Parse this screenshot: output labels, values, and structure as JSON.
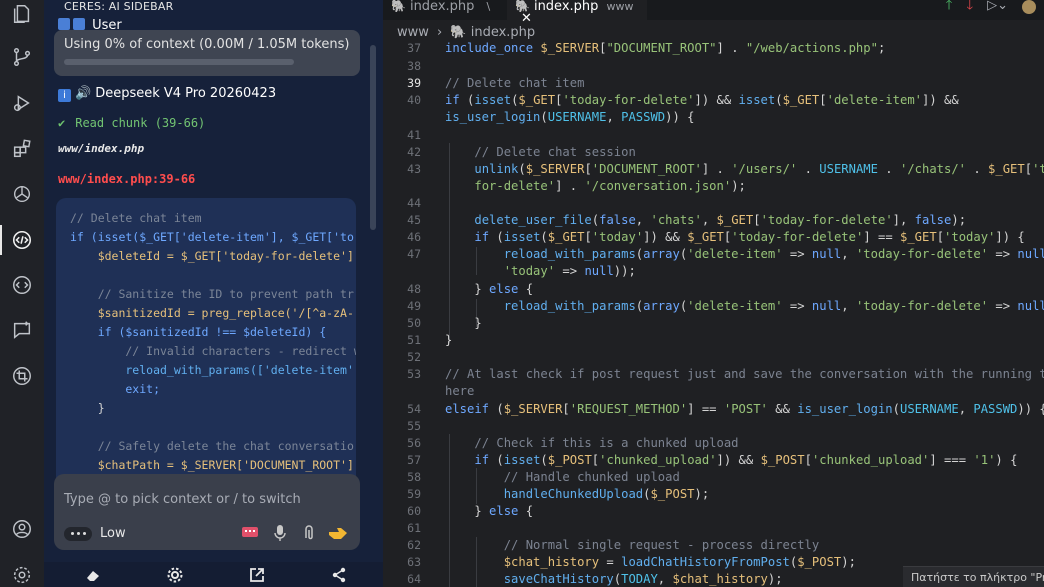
{
  "sidebar": {
    "title": "CERES: AI SIDEBAR",
    "user_label": "User",
    "context_usage": "Using 0% of context (0.00M / 1.05M tokens)",
    "model_label": "Deepseek V4 Pro 20260423",
    "read_status": "Read chunk (39-66)",
    "file_path": "www/index.php",
    "file_range": "www/index.php:39-66",
    "snippet_lines": [
      "// Delete chat item",
      "if (isset($_GET['delete-item'], $_GET['to",
      "    $deleteId = $_GET['today-for-delete']",
      "",
      "    // Sanitize the ID to prevent path tr",
      "    $sanitizedId = preg_replace('/[^a-zA-",
      "    if ($sanitizedId !== $deleteId) {",
      "        // Invalid characters - redirect w",
      "        reload_with_params(['delete-item'",
      "        exit;",
      "    }",
      "",
      "    // Safely delete the chat conversatio",
      "    $chatPath = $_SERVER['DOCUMENT_ROOT']"
    ],
    "composer_placeholder": "Type @ to pick context or / to switch",
    "effort_label": "Low"
  },
  "editor": {
    "tabs": [
      {
        "label": "index.php",
        "suffix": "\\"
      },
      {
        "label": "index.php",
        "suffix": "www"
      }
    ],
    "breadcrumb": [
      "www",
      "index.php"
    ],
    "tooltip": "Πατήστε το πλήκτρο \"Prnt"
  }
}
